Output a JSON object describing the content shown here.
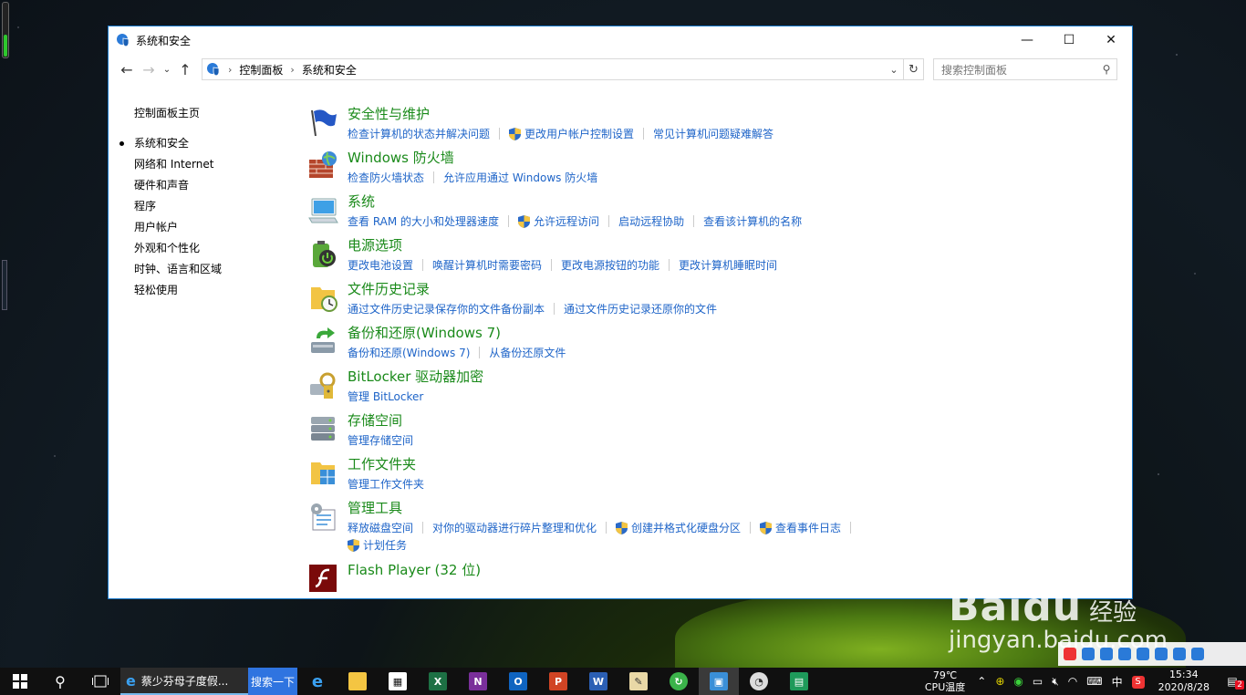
{
  "window": {
    "title": "系统和安全",
    "controls": {
      "minimize": "—",
      "maximize": "☐",
      "close": "✕"
    }
  },
  "address": {
    "crumbs": [
      "控制面板",
      "系统和安全"
    ],
    "search_placeholder": "搜索控制面板"
  },
  "leftnav": {
    "home": "控制面板主页",
    "items": [
      "系统和安全",
      "网络和 Internet",
      "硬件和声音",
      "程序",
      "用户帐户",
      "外观和个性化",
      "时钟、语言和区域",
      "轻松使用"
    ],
    "current_index": 0
  },
  "categories": [
    {
      "title": "安全性与维护",
      "icon": "flag-icon",
      "links": [
        {
          "text": "检查计算机的状态并解决问题",
          "shield": false
        },
        {
          "text": "更改用户帐户控制设置",
          "shield": true
        },
        {
          "text": "常见计算机问题疑难解答",
          "shield": false
        }
      ]
    },
    {
      "title": "Windows 防火墙",
      "icon": "firewall-icon",
      "links": [
        {
          "text": "检查防火墙状态",
          "shield": false
        },
        {
          "text": "允许应用通过 Windows 防火墙",
          "shield": false
        }
      ]
    },
    {
      "title": "系统",
      "icon": "computer-icon",
      "links": [
        {
          "text": "查看 RAM 的大小和处理器速度",
          "shield": false
        },
        {
          "text": "允许远程访问",
          "shield": true
        },
        {
          "text": "启动远程协助",
          "shield": false
        },
        {
          "text": "查看该计算机的名称",
          "shield": false
        }
      ]
    },
    {
      "title": "电源选项",
      "icon": "power-battery-icon",
      "links": [
        {
          "text": "更改电池设置",
          "shield": false
        },
        {
          "text": "唤醒计算机时需要密码",
          "shield": false
        },
        {
          "text": "更改电源按钮的功能",
          "shield": false
        },
        {
          "text": "更改计算机睡眠时间",
          "shield": false
        }
      ]
    },
    {
      "title": "文件历史记录",
      "icon": "file-history-icon",
      "links": [
        {
          "text": "通过文件历史记录保存你的文件备份副本",
          "shield": false
        },
        {
          "text": "通过文件历史记录还原你的文件",
          "shield": false
        }
      ]
    },
    {
      "title": "备份和还原(Windows 7)",
      "icon": "backup-icon",
      "links": [
        {
          "text": "备份和还原(Windows 7)",
          "shield": false
        },
        {
          "text": "从备份还原文件",
          "shield": false
        }
      ]
    },
    {
      "title": "BitLocker 驱动器加密",
      "icon": "bitlocker-icon",
      "links": [
        {
          "text": "管理 BitLocker",
          "shield": false
        }
      ]
    },
    {
      "title": "存储空间",
      "icon": "storage-icon",
      "links": [
        {
          "text": "管理存储空间",
          "shield": false
        }
      ]
    },
    {
      "title": "工作文件夹",
      "icon": "work-folders-icon",
      "links": [
        {
          "text": "管理工作文件夹",
          "shield": false
        }
      ]
    },
    {
      "title": "管理工具",
      "icon": "admin-tools-icon",
      "links": [
        {
          "text": "释放磁盘空间",
          "shield": false
        },
        {
          "text": "对你的驱动器进行碎片整理和优化",
          "shield": false
        },
        {
          "text": "创建并格式化硬盘分区",
          "shield": true
        },
        {
          "text": "查看事件日志",
          "shield": true
        },
        {
          "text": "计划任务",
          "shield": true
        }
      ]
    },
    {
      "title": "Flash Player (32 位)",
      "icon": "flash-icon",
      "links": []
    }
  ],
  "colors": {
    "category_title": "#1a8a1a",
    "link": "#1e64c8",
    "window_border": "#1979ca",
    "taskbar": "#101010"
  },
  "taskbar": {
    "ie_task_label": "蔡少芬母子度假...",
    "search_button": "搜索一下",
    "temp": "79℃",
    "temp_label": "CPU温度",
    "ime": "中",
    "time": "15:34",
    "date": "2020/8/28",
    "notif_count": "2"
  },
  "watermark": {
    "brand": "Baidu",
    "cn": "经验",
    "url": "jingyan.baidu.com"
  }
}
